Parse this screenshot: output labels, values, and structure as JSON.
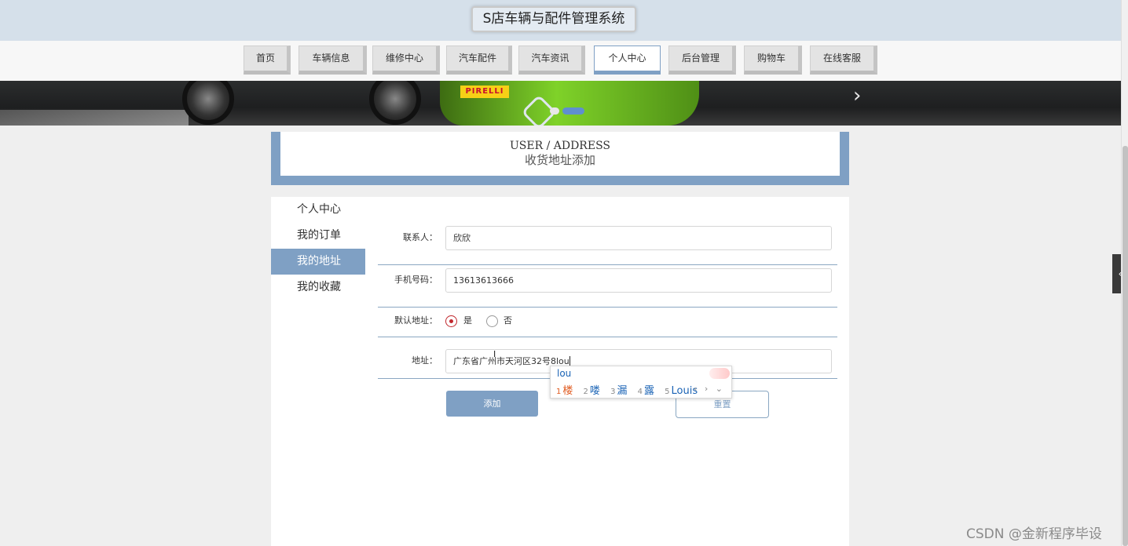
{
  "header": {
    "title": "S店车辆与配件管理系统"
  },
  "nav": {
    "items": [
      {
        "label": "首页"
      },
      {
        "label": "车辆信息"
      },
      {
        "label": "维修中心"
      },
      {
        "label": "汽车配件"
      },
      {
        "label": "汽车资讯"
      },
      {
        "label": "个人中心"
      },
      {
        "label": "后台管理"
      },
      {
        "label": "购物车"
      },
      {
        "label": "在线客服"
      }
    ],
    "active": "个人中心"
  },
  "banner": {
    "brand_text": "PIRELLI"
  },
  "page_title": {
    "en": "USER / ADDRESS",
    "cn": "收货地址添加"
  },
  "sidebar": {
    "items": [
      {
        "label": "个人中心"
      },
      {
        "label": "我的订单"
      },
      {
        "label": "我的地址"
      },
      {
        "label": "我的收藏"
      }
    ],
    "active": "我的地址"
  },
  "form": {
    "contact": {
      "label": "联系人：",
      "value": "欣欣"
    },
    "phone": {
      "label": "手机号码：",
      "value": "13613613666"
    },
    "default_address": {
      "label": "默认地址：",
      "options": [
        {
          "label": "是",
          "checked": true
        },
        {
          "label": "否",
          "checked": false
        }
      ]
    },
    "address": {
      "label": "地址：",
      "value": "广东省广州市天河区32号8lou"
    },
    "add_button": "添加",
    "reset_button": "重置"
  },
  "ime": {
    "composition": "lou",
    "candidates": [
      {
        "num": "1",
        "text": "楼"
      },
      {
        "num": "2",
        "text": "喽"
      },
      {
        "num": "3",
        "text": "漏"
      },
      {
        "num": "4",
        "text": "露"
      },
      {
        "num": "5",
        "text": "Louis"
      }
    ],
    "nav_symbols": "‹ › ⌄"
  },
  "side_toggle": {
    "symbol": "‹"
  },
  "watermark": "CSDN @金新程序毕设",
  "colors": {
    "accent": "#7fa0c4",
    "header_bg": "#d5e0ea",
    "radio_checked": "#c1272d",
    "ime_first": "#e05a1f",
    "ime_candidate": "#1a63b5"
  }
}
